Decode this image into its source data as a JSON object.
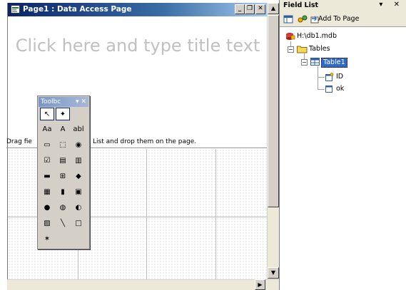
{
  "window": {
    "title": "Page1 : Data Access Page",
    "minimize_glyph": "_",
    "restore_glyph": "❐",
    "close_glyph": "✕"
  },
  "page": {
    "title_placeholder": "Click here and type title text",
    "drag_hint_left": "Drag fie",
    "drag_hint_right": "ld List and drop them on the page."
  },
  "toolbox": {
    "title": "Toolbc",
    "controls": "▾ ✕",
    "tools": [
      {
        "name": "select-objects-tool",
        "glyph": "↖",
        "selected": true
      },
      {
        "name": "control-wizards-tool",
        "glyph": "✦",
        "selected": true
      },
      {
        "name": "label-tool",
        "glyph": "Aa"
      },
      {
        "name": "bound-html-tool",
        "glyph": "A"
      },
      {
        "name": "textbox-tool",
        "glyph": "abl"
      },
      {
        "name": "scrolling-text-tool",
        "glyph": "▭"
      },
      {
        "name": "option-group-tool",
        "glyph": "⬚"
      },
      {
        "name": "option-button-tool",
        "glyph": "◉"
      },
      {
        "name": "check-box-tool",
        "glyph": "☑"
      },
      {
        "name": "dropdown-list-tool",
        "glyph": "▤"
      },
      {
        "name": "list-box-tool",
        "glyph": "▥"
      },
      {
        "name": "command-button-tool",
        "glyph": "▬"
      },
      {
        "name": "expand-tool",
        "glyph": "⊞"
      },
      {
        "name": "record-navigation-tool",
        "glyph": "◆"
      },
      {
        "name": "office-pivottable-tool",
        "glyph": "▦"
      },
      {
        "name": "office-chart-tool",
        "glyph": "▮"
      },
      {
        "name": "office-spreadsheet-tool",
        "glyph": "▣"
      },
      {
        "name": "hyperlink-tool",
        "glyph": "●"
      },
      {
        "name": "image-hyperlink-tool",
        "glyph": "◍"
      },
      {
        "name": "movie-tool",
        "glyph": "◐"
      },
      {
        "name": "image-tool",
        "glyph": "▨"
      },
      {
        "name": "line-tool",
        "glyph": "╲"
      },
      {
        "name": "rectangle-tool",
        "glyph": "□"
      },
      {
        "name": "more-controls-tool",
        "glyph": "✶"
      }
    ]
  },
  "field_list": {
    "title": "Field List",
    "header_controls": "▾ ✕",
    "add_to_page": "Add To Page",
    "tree": {
      "database": "H:\\db1.mdb",
      "tables_folder": "Tables",
      "table": "Table1",
      "fields": [
        "ID",
        "ok"
      ]
    }
  },
  "colors": {
    "titlebar_active": "#0a246a",
    "toolbox_title": "#7a96c2",
    "selection": "#316ac5"
  }
}
